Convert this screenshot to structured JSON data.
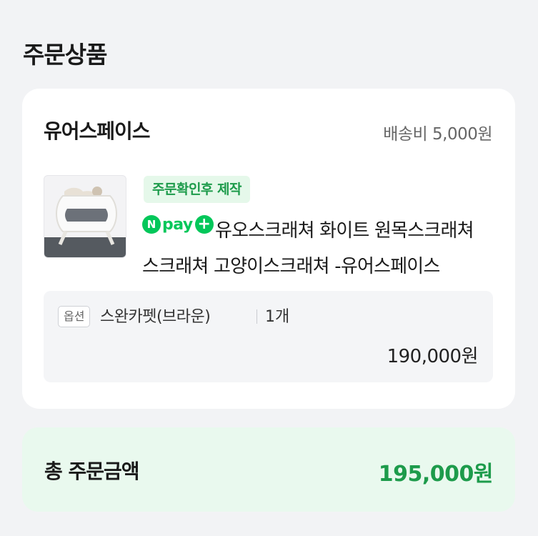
{
  "section_title": "주문상품",
  "seller": {
    "name": "유어스페이스",
    "shipping_fee": "배송비 5,000원"
  },
  "product": {
    "badge": "주문확인후 제작",
    "npay_label": "pay",
    "npay_icon": "npay-plus-icon",
    "title": "유오스크래쳐 화이트 원목스크래쳐 스크래쳐 고양이스크래쳐 -유어스페이스"
  },
  "option": {
    "tag": "옵션",
    "name": "스완카펫(브라운)",
    "quantity": "1개",
    "price": "190,000원"
  },
  "total": {
    "label": "총 주문금액",
    "amount": "195,000원"
  },
  "colors": {
    "accent_green": "#03c75a",
    "total_green": "#1d9b4b",
    "badge_bg": "#e5f8ea"
  }
}
